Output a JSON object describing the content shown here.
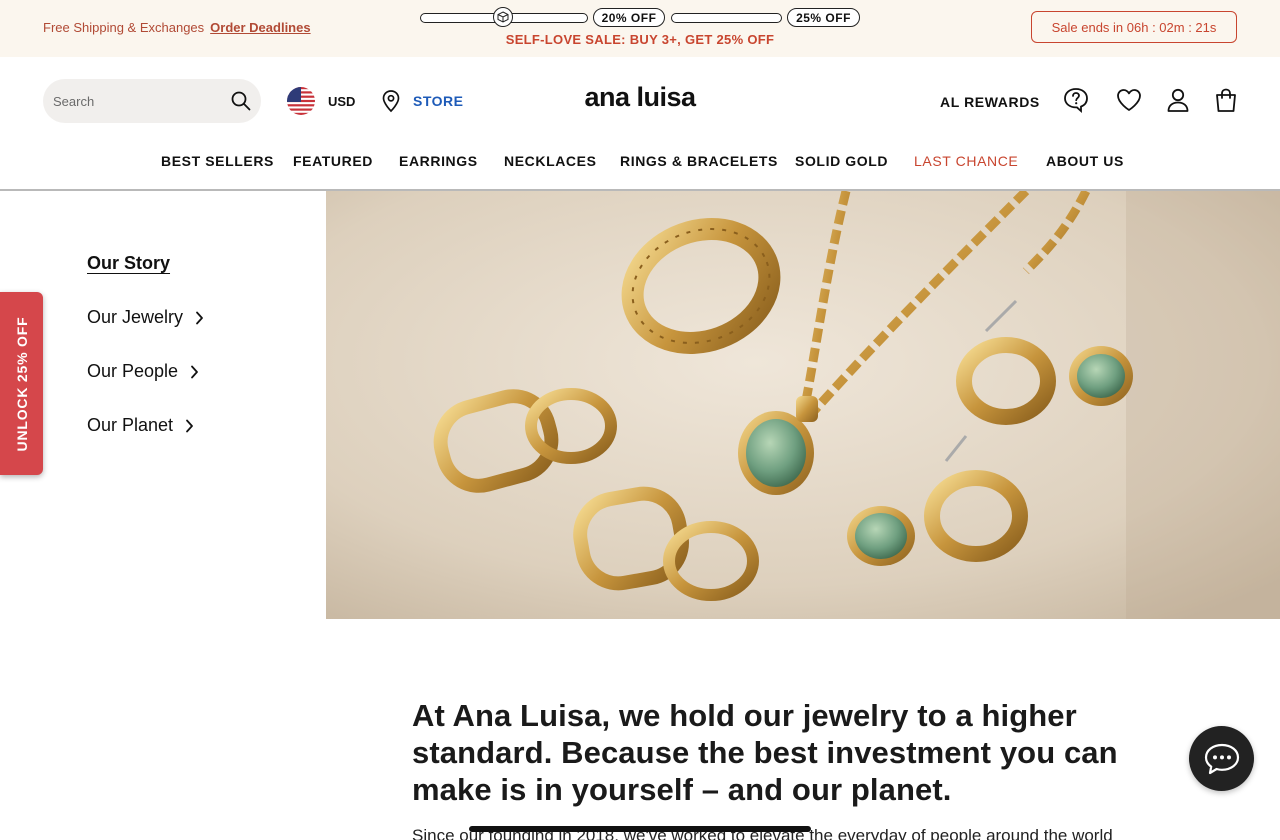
{
  "promo": {
    "shipping_text": "Free Shipping & Exchanges",
    "deadline_link": "Order Deadlines",
    "tier1_label": "20% OFF",
    "tier2_label": "25% OFF",
    "sale_text": "SELF-LOVE SALE: BUY 3+, GET 25% OFF",
    "countdown": "Sale ends in 06h : 02m : 21s"
  },
  "header": {
    "search_placeholder": "Search",
    "currency": "USD",
    "store_label": "STORE",
    "logo": "ana luisa",
    "rewards": "AL REWARDS"
  },
  "nav": {
    "items": [
      "BEST SELLERS",
      "FEATURED",
      "EARRINGS",
      "NECKLACES",
      "RINGS & BRACELETS",
      "SOLID GOLD",
      "LAST CHANCE",
      "ABOUT US"
    ]
  },
  "side_menu": {
    "items": [
      "Our Story",
      "Our Jewelry",
      "Our People",
      "Our Planet"
    ]
  },
  "unlock_tab": "UNLOCK 25% OFF",
  "content": {
    "headline": "At Ana Luisa, we hold our jewelry to a higher standard. Because the best investment you can make is in yourself – and our planet.",
    "body_start": "Since our founding in 2018, we've worked to elevate the everyday of people around the world"
  },
  "colors": {
    "promo_bg": "#fbf6ee",
    "accent_red": "#c8452f",
    "store_blue": "#1e5bb8",
    "unlock_bg": "#d5474b"
  }
}
